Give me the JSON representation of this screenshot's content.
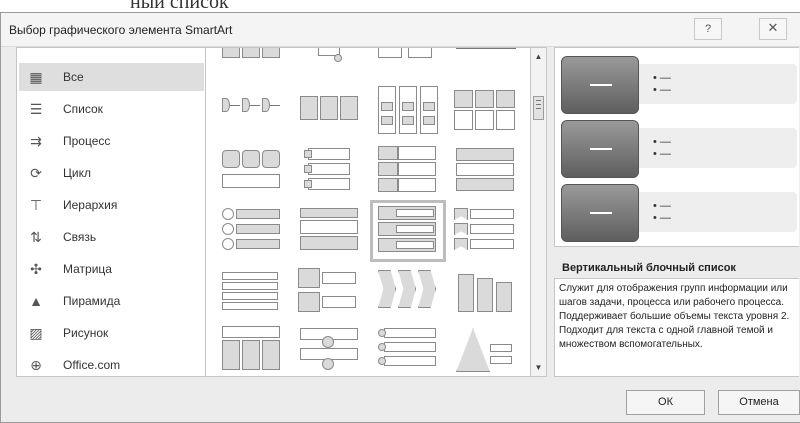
{
  "page_fragment": "ный список",
  "dialog": {
    "title": "Выбор графического элемента SmartArt",
    "help_button": "?",
    "close_button": "✕"
  },
  "categories": [
    {
      "label": "Все",
      "icon": "all-icon",
      "glyph": "▦",
      "selected": true
    },
    {
      "label": "Список",
      "icon": "list-icon",
      "glyph": "☰"
    },
    {
      "label": "Процесс",
      "icon": "process-icon",
      "glyph": "⇉"
    },
    {
      "label": "Цикл",
      "icon": "cycle-icon",
      "glyph": "⟳"
    },
    {
      "label": "Иерархия",
      "icon": "hierarchy-icon",
      "glyph": "⊤"
    },
    {
      "label": "Связь",
      "icon": "relationship-icon",
      "glyph": "⇅"
    },
    {
      "label": "Матрица",
      "icon": "matrix-icon",
      "glyph": "✣"
    },
    {
      "label": "Пирамида",
      "icon": "pyramid-icon",
      "glyph": "▲"
    },
    {
      "label": "Рисунок",
      "icon": "picture-icon",
      "glyph": "▨"
    },
    {
      "label": "Office.com",
      "icon": "globe-icon",
      "glyph": "⊕"
    }
  ],
  "gallery": {
    "selected_layout": "Вертикальный блочный список"
  },
  "preview": {
    "bullets": [
      "• —\n• —",
      "• —\n• —",
      "• —\n• —"
    ]
  },
  "description": {
    "title": "Вертикальный блочный список",
    "text": "Служит для отображения групп информации или шагов задачи, процесса или рабочего процесса. Поддерживает большие объемы текста уровня 2. Подходит для текста с одной главной темой и множеством вспомогательных."
  },
  "buttons": {
    "ok": "ОК",
    "cancel": "Отмена"
  },
  "colors": {
    "dialog_bg": "#ececec",
    "preview_block": "#6f6f6f",
    "selection": "#dedede"
  }
}
